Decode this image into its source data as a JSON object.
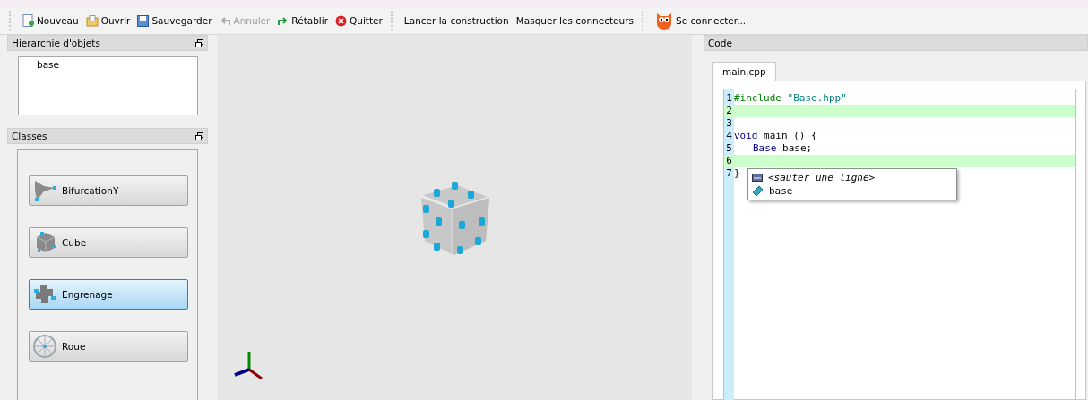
{
  "toolbar": {
    "groups": [
      {
        "items": [
          {
            "label": "Nouveau",
            "disabled": false
          },
          {
            "label": "Ouvrir",
            "disabled": false
          },
          {
            "label": "Sauvegarder",
            "disabled": false
          },
          {
            "label": "Annuler",
            "disabled": true
          },
          {
            "label": "Rétablir",
            "disabled": false
          },
          {
            "label": "Quitter",
            "disabled": false
          }
        ]
      },
      {
        "items": [
          {
            "label": "Lancer la construction",
            "disabled": false
          },
          {
            "label": "Masquer les connecteurs",
            "disabled": false
          }
        ]
      },
      {
        "items": [
          {
            "label": "Se connecter...",
            "disabled": false
          }
        ]
      }
    ]
  },
  "hierarchy": {
    "title": "Hierarchie d'objets",
    "items": [
      "base"
    ]
  },
  "classes": {
    "title": "Classes",
    "items": [
      {
        "label": "BifurcationY",
        "selected": false
      },
      {
        "label": "Cube",
        "selected": false
      },
      {
        "label": "Engrenage",
        "selected": true
      },
      {
        "label": "Roue",
        "selected": false
      }
    ]
  },
  "code": {
    "title": "Code",
    "tabs": [
      {
        "label": "main.cpp",
        "selected": true
      }
    ],
    "lines": [
      {
        "number": "1",
        "highlighted": false,
        "indented": false,
        "tokens": [
          {
            "kind": "directive",
            "text": "#include"
          },
          {
            "kind": "string",
            "text": " \"Base.hpp\""
          }
        ]
      },
      {
        "number": "2",
        "highlighted": true
      },
      {
        "number": "3",
        "highlighted": false
      },
      {
        "number": "4",
        "highlighted": false,
        "indented": false,
        "tokens": [
          {
            "kind": "keyword",
            "text": "void"
          },
          {
            "kind": "plain",
            "text": " main () {"
          }
        ]
      },
      {
        "number": "5",
        "highlighted": false,
        "indented": true,
        "tokens": [
          {
            "kind": "keyword",
            "text": "Base"
          },
          {
            "kind": "plain",
            "text": " base;"
          }
        ]
      },
      {
        "number": "6",
        "highlighted": true
      },
      {
        "number": "7",
        "highlighted": false,
        "indented": false,
        "tokens": [
          {
            "kind": "plain",
            "text": "}"
          }
        ]
      }
    ],
    "completions": [
      {
        "label": "<sauter une ligne>",
        "kind": "snippet"
      },
      {
        "label": "base",
        "kind": "variable"
      }
    ]
  }
}
